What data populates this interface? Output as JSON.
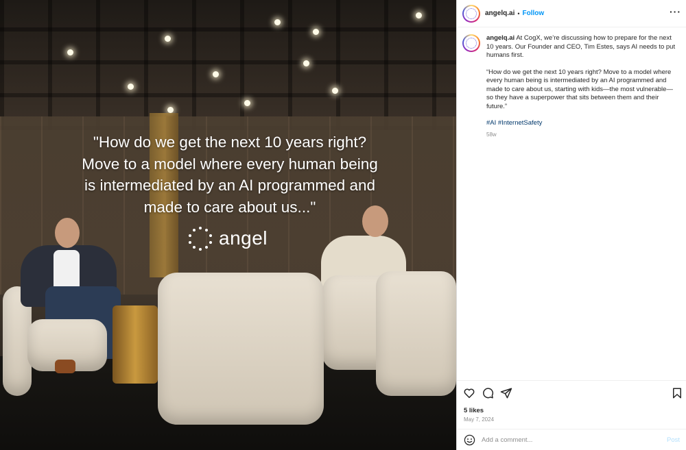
{
  "post": {
    "image": {
      "quote_line1": "\"How do we get the next 10 years right?",
      "quote_line2": "Move to a model where every human being",
      "quote_line3": "is intermediated by an AI programmed and",
      "quote_line4": "made to care about us...\"",
      "brand_name": "angel"
    },
    "header": {
      "username": "angelq.ai",
      "separator": "•",
      "follow_label": "Follow",
      "more_icon": "more-horizontal-icon"
    },
    "caption": {
      "username": "angelq.ai",
      "paragraph1": "At CogX, we’re discussing how to prepare for the next 10 years. Our Founder and CEO, Tim Estes, says AI needs to put humans first.",
      "paragraph2": "“How do we get the next 10 years right? Move to a model where every human being is intermediated by an AI programmed and made to care about us, starting with kids—the most vulnerable—so they have a superpower that sits between them and their future.”",
      "hashtag1": "#AI",
      "hashtag2": "#InternetSafety",
      "age": "58w"
    },
    "actions": {
      "like_icon": "heart-icon",
      "comment_icon": "comment-icon",
      "share_icon": "share-icon",
      "save_icon": "bookmark-icon",
      "likes": "5 likes",
      "date": "May 7, 2024"
    },
    "comment": {
      "placeholder": "Add a comment...",
      "post_label": "Post",
      "emoji_icon": "emoji-icon"
    },
    "colors": {
      "link_blue": "#0095f6",
      "hashtag": "#00376b",
      "muted": "#8e8e8e",
      "post_disabled": "#b2dffc"
    }
  }
}
